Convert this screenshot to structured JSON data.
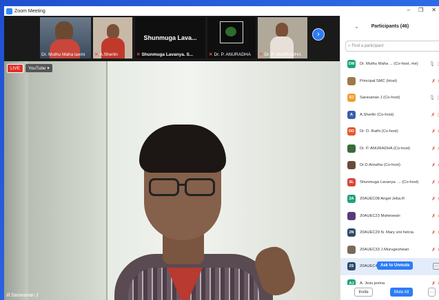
{
  "window": {
    "title": "Zoom Meeting",
    "minimize": "–",
    "restore": "❐",
    "close": "✕"
  },
  "gallery": [
    {
      "name": "Dr. Muthu Maha laxmi",
      "muted": false
    },
    {
      "name": "A.Sherlin",
      "muted": true
    },
    {
      "name": "Shunmuga Lavanya. S...",
      "muted": true,
      "display_text": "Shunmuga  Lava..."
    },
    {
      "name": "Dr. P. ANURADHA",
      "muted": true
    },
    {
      "name": "Dr. P. ANURADHA",
      "muted": true
    }
  ],
  "next_icon": "›",
  "main": {
    "live_label": "LIVE",
    "youtube_label": "YouTube ▾",
    "speaker": "Saravanan J"
  },
  "panel": {
    "title": "Participants (46)",
    "search_placeholder": "Find a participant",
    "participants": [
      {
        "initials": "DM",
        "color": "#1fa37a",
        "name": "Dr. Muthu Maha ... (Co-host, me)",
        "muted": false
      },
      {
        "initials": "",
        "color": "#9b7a4a",
        "name": "Principal SMC (Host)",
        "muted": true
      },
      {
        "initials": "SJ",
        "color": "#f0a030",
        "name": "Saravanan J (Co-host)",
        "muted": false
      },
      {
        "initials": "A",
        "color": "#3a5fa8",
        "name": "A.Sherlin (Co-host)",
        "muted": true
      },
      {
        "initials": "DD",
        "color": "#e4572e",
        "name": "Dr. D. Rathi (Co-host)",
        "muted": true
      },
      {
        "initials": "",
        "color": "#3a6b3a",
        "name": "Dr. P. ANURADHA (Co-host)",
        "muted": true
      },
      {
        "initials": "",
        "color": "#6b4a3a",
        "name": "Dr.D.Amutha (Co-host)",
        "muted": true
      },
      {
        "initials": "SL",
        "color": "#d8453a",
        "name": "Shunmuga Lavanya. ... (Co-host)",
        "muted": true
      },
      {
        "initials": "2A",
        "color": "#1fa37a",
        "name": "20AUEC08 Angel Jeba.R",
        "muted": true
      },
      {
        "initials": "",
        "color": "#5a3a7a",
        "name": "20AUEC23 Maheswari",
        "muted": true
      },
      {
        "initials": "2N",
        "color": "#2e4a6b",
        "name": "20AUEC29 N. Mary vini helcia",
        "muted": true
      },
      {
        "initials": "",
        "color": "#7a6a5a",
        "name": "20AUEC33 J.Murugeshwari",
        "muted": true
      },
      {
        "initials": "2S",
        "color": "#2e4a6b",
        "name": "20AUEC46 Shar",
        "muted": true,
        "highlight": true
      },
      {
        "initials": "AJ",
        "color": "#1fa37a",
        "name": "A. Jesu jesina",
        "muted": true
      }
    ],
    "ask_to_unmute": "Ask to Unmute",
    "invite": "Invite",
    "mute_all": "Mute All",
    "more": "···"
  }
}
